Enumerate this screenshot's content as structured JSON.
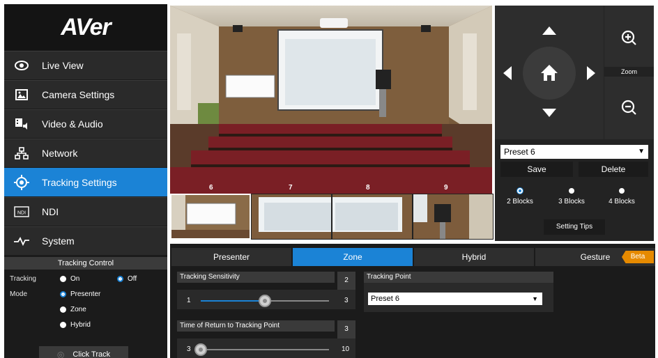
{
  "brand": {
    "logo_text": "AVer"
  },
  "sidebar": {
    "items": [
      {
        "label": "Live View",
        "icon": "eye-icon",
        "active": false
      },
      {
        "label": "Camera Settings",
        "icon": "image-icon",
        "active": false
      },
      {
        "label": "Video & Audio",
        "icon": "video-audio-icon",
        "active": false
      },
      {
        "label": "Network",
        "icon": "network-icon",
        "active": false
      },
      {
        "label": "Tracking Settings",
        "icon": "crosshair-icon",
        "active": true
      },
      {
        "label": "NDI",
        "icon": "ndi-icon",
        "active": false
      },
      {
        "label": "System",
        "icon": "pulse-icon",
        "active": false
      }
    ]
  },
  "tracking_control": {
    "title": "Tracking Control",
    "tracking_label": "Tracking",
    "on_label": "On",
    "off_label": "Off",
    "mode_label": "Mode",
    "modes": [
      "Presenter",
      "Zone",
      "Hybrid"
    ],
    "selected_tracking": "Off",
    "selected_mode": "Presenter",
    "click_track_label": "Click Track"
  },
  "video": {
    "block_numbers": [
      "6",
      "7",
      "8",
      "9"
    ]
  },
  "ptz": {
    "zoom_label": "Zoom",
    "preset_selected": "Preset 6",
    "save_label": "Save",
    "delete_label": "Delete",
    "blocks": [
      {
        "label": "2 Blocks",
        "selected": true
      },
      {
        "label": "3 Blocks",
        "selected": false
      },
      {
        "label": "4 Blocks",
        "selected": false
      }
    ],
    "setting_tips_label": "Setting Tips"
  },
  "tabs": [
    {
      "label": "Presenter",
      "active": false
    },
    {
      "label": "Zone",
      "active": true
    },
    {
      "label": "Hybrid",
      "active": false
    },
    {
      "label": "Gesture",
      "active": false
    }
  ],
  "beta_label": "Beta",
  "sensitivity": {
    "title": "Tracking Sensitivity",
    "value": "2",
    "min": "1",
    "max": "3",
    "level": 0.5
  },
  "return_time": {
    "title": "Time of Return to Tracking Point",
    "value": "3",
    "min": "3",
    "max": "10",
    "level": 0.0
  },
  "tracking_point": {
    "title": "Tracking Point",
    "selected": "Preset 6"
  },
  "colors": {
    "accent": "#1b83d6",
    "beta": "#e68a00",
    "panel": "#1b1b1b"
  }
}
